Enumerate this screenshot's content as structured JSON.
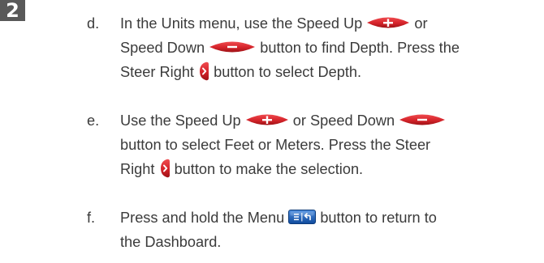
{
  "step_number": "2",
  "steps": [
    {
      "letter": "d.",
      "lines": [
        [
          "In the Units menu, use the Speed Up ",
          " or"
        ],
        [
          "Speed Down ",
          " button to find Depth. Press the"
        ],
        [
          "Steer Right ",
          " button to select Depth."
        ]
      ]
    },
    {
      "letter": "e.",
      "lines": [
        [
          "Use the Speed Up ",
          " or Speed Down "
        ],
        [
          "button to select Feet or Meters. Press the Steer"
        ],
        [
          "Right ",
          " button to make the selection."
        ]
      ]
    },
    {
      "letter": "f.",
      "lines": [
        [
          "Press and hold the Menu ",
          " button to return to"
        ],
        [
          "the Dashboard."
        ]
      ]
    }
  ],
  "icons": {
    "speed_up": "speed-up-button-icon",
    "speed_down": "speed-down-button-icon",
    "steer_right": "steer-right-button-icon",
    "menu": "menu-button-icon"
  },
  "colors": {
    "badge": "#595959",
    "button_red": "#d5232a",
    "menu_blue": "#1a5fb4"
  }
}
